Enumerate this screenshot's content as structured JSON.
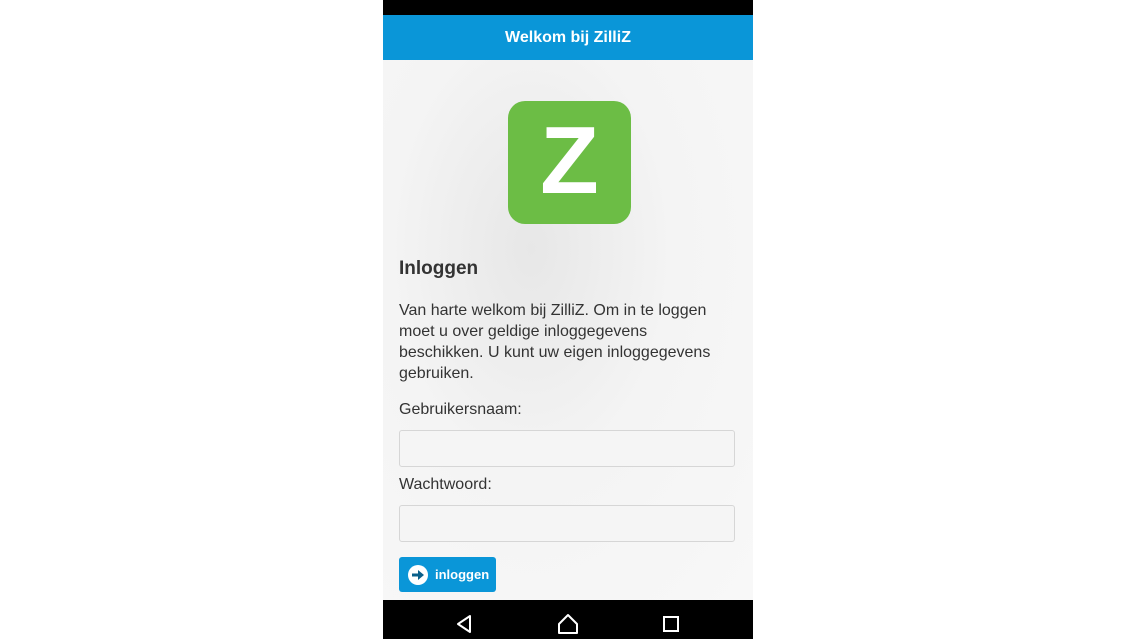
{
  "header": {
    "title": "Welkom bij ZilliZ"
  },
  "logo": {
    "letter": "Z",
    "color": "#6cbd45"
  },
  "login": {
    "title": "Inloggen",
    "intro": "Van harte welkom bij ZilliZ. Om in te loggen moet u over geldige inloggegevens beschikken. U kunt uw eigen inloggegevens gebruiken.",
    "username_label": "Gebruikersnaam:",
    "username_value": "",
    "password_label": "Wachtwoord:",
    "password_value": "",
    "button_label": "inloggen",
    "button_icon": "arrow-right-icon"
  },
  "nav_bar": {
    "items": [
      "back-icon",
      "home-icon",
      "recent-apps-icon"
    ]
  },
  "colors": {
    "accent": "#0a96d8",
    "background": "#f3f3f3"
  }
}
